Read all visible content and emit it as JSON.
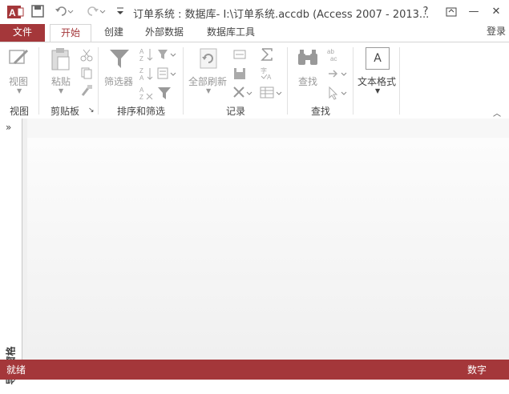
{
  "window": {
    "title": "订单系统 : 数据库- I:\\订单系统.accdb (Access 2007 - 2013...",
    "help": "?",
    "minimize": "—",
    "restore": "▭",
    "close": "✕"
  },
  "tabs": [
    {
      "label": "文件"
    },
    {
      "label": "开始"
    },
    {
      "label": "创建"
    },
    {
      "label": "外部数据"
    },
    {
      "label": "数据库工具"
    }
  ],
  "login": "登录",
  "ribbon": {
    "groups": [
      {
        "label": "视图"
      },
      {
        "label": "剪贴板"
      },
      {
        "label": "排序和筛选"
      },
      {
        "label": "记录"
      },
      {
        "label": "查找"
      }
    ],
    "buttons": {
      "view": "视图",
      "paste": "粘贴",
      "filter": "筛选器",
      "refresh_all": "全部刷新",
      "find": "查找",
      "text_format": "文本格式",
      "text_format_glyph": "A"
    }
  },
  "nav_pane": {
    "label": "导航窗格",
    "chevron": "»"
  },
  "status": {
    "left": "就绪",
    "right": "数字"
  },
  "colors": {
    "accent": "#a4373a"
  }
}
